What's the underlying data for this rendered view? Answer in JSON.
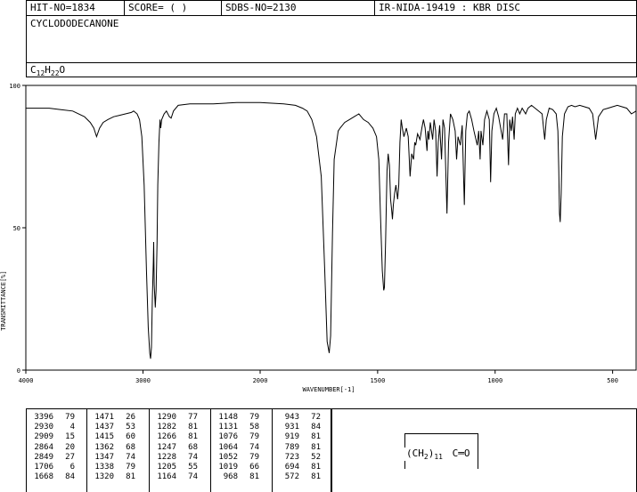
{
  "header": {
    "hit_no": "HIT-NO=1834",
    "score": "SCORE=  (   )",
    "sdbs_no": "SDBS-NO=2130",
    "ir_nida": "IR-NIDA-19419 : KBR DISC",
    "compound_name": "CYCLODODECANONE",
    "formula": {
      "c": "C",
      "c_sub": "12",
      "h": "H",
      "h_sub": "22",
      "o": "O"
    }
  },
  "chart_data": {
    "type": "line",
    "xlabel": "WAVENUMBER[-1]",
    "ylabel": "TRANSMITTANCE[%]",
    "xlim": [
      4000,
      400
    ],
    "ylim": [
      0,
      100
    ],
    "x_ticks": [
      4000,
      3000,
      2000,
      1500,
      1000,
      500
    ],
    "x_tick_labels": [
      "4000",
      "3000",
      "2000",
      "1500",
      "1000",
      "500"
    ],
    "y_ticks": [
      0,
      50,
      100
    ],
    "y_tick_labels": [
      "0",
      "50",
      "100"
    ],
    "series": [
      {
        "points": [
          [
            4000,
            92
          ],
          [
            3900,
            92
          ],
          [
            3800,
            92
          ],
          [
            3700,
            91.5
          ],
          [
            3600,
            91
          ],
          [
            3500,
            89
          ],
          [
            3450,
            87
          ],
          [
            3420,
            85
          ],
          [
            3396,
            82
          ],
          [
            3370,
            85
          ],
          [
            3340,
            87
          ],
          [
            3300,
            88
          ],
          [
            3250,
            89
          ],
          [
            3200,
            89.5
          ],
          [
            3150,
            90
          ],
          [
            3100,
            90.5
          ],
          [
            3080,
            91
          ],
          [
            3050,
            90
          ],
          [
            3030,
            88
          ],
          [
            3010,
            82
          ],
          [
            2990,
            65
          ],
          [
            2970,
            35
          ],
          [
            2955,
            15
          ],
          [
            2942,
            6
          ],
          [
            2935,
            4
          ],
          [
            2928,
            8
          ],
          [
            2920,
            25
          ],
          [
            2912,
            38
          ],
          [
            2909,
            45
          ],
          [
            2904,
            30
          ],
          [
            2895,
            22
          ],
          [
            2888,
            28
          ],
          [
            2880,
            45
          ],
          [
            2874,
            65
          ],
          [
            2864,
            80
          ],
          [
            2855,
            88
          ],
          [
            2849,
            85
          ],
          [
            2840,
            88
          ],
          [
            2820,
            90
          ],
          [
            2800,
            91
          ],
          [
            2775,
            89
          ],
          [
            2760,
            88.5
          ],
          [
            2740,
            91
          ],
          [
            2700,
            93
          ],
          [
            2600,
            93.5
          ],
          [
            2400,
            93.5
          ],
          [
            2200,
            94
          ],
          [
            2000,
            94
          ],
          [
            1900,
            93.5
          ],
          [
            1850,
            93
          ],
          [
            1820,
            92
          ],
          [
            1800,
            91
          ],
          [
            1780,
            88
          ],
          [
            1760,
            82
          ],
          [
            1740,
            68
          ],
          [
            1725,
            35
          ],
          [
            1715,
            10
          ],
          [
            1706,
            6
          ],
          [
            1700,
            12
          ],
          [
            1692,
            48
          ],
          [
            1685,
            74
          ],
          [
            1668,
            84
          ],
          [
            1660,
            85
          ],
          [
            1640,
            87
          ],
          [
            1620,
            88
          ],
          [
            1600,
            89
          ],
          [
            1580,
            90
          ],
          [
            1560,
            88
          ],
          [
            1540,
            87
          ],
          [
            1520,
            85
          ],
          [
            1505,
            82
          ],
          [
            1495,
            74
          ],
          [
            1488,
            55
          ],
          [
            1480,
            35
          ],
          [
            1474,
            28
          ],
          [
            1471,
            29
          ],
          [
            1466,
            45
          ],
          [
            1460,
            70
          ],
          [
            1455,
            76
          ],
          [
            1450,
            72
          ],
          [
            1445,
            60
          ],
          [
            1440,
            56
          ],
          [
            1437,
            53
          ],
          [
            1433,
            58
          ],
          [
            1428,
            62
          ],
          [
            1422,
            65
          ],
          [
            1415,
            60
          ],
          [
            1410,
            65
          ],
          [
            1405,
            80
          ],
          [
            1400,
            88
          ],
          [
            1395,
            85
          ],
          [
            1388,
            82
          ],
          [
            1378,
            85
          ],
          [
            1370,
            82
          ],
          [
            1362,
            68
          ],
          [
            1355,
            76
          ],
          [
            1347,
            74
          ],
          [
            1342,
            80
          ],
          [
            1338,
            79
          ],
          [
            1330,
            83
          ],
          [
            1320,
            81
          ],
          [
            1312,
            85
          ],
          [
            1305,
            88
          ],
          [
            1298,
            85
          ],
          [
            1290,
            77
          ],
          [
            1286,
            84
          ],
          [
            1282,
            81
          ],
          [
            1276,
            87
          ],
          [
            1266,
            81
          ],
          [
            1260,
            88
          ],
          [
            1253,
            84
          ],
          [
            1247,
            68
          ],
          [
            1242,
            80
          ],
          [
            1236,
            86
          ],
          [
            1228,
            74
          ],
          [
            1222,
            88
          ],
          [
            1215,
            85
          ],
          [
            1205,
            55
          ],
          [
            1198,
            80
          ],
          [
            1190,
            90
          ],
          [
            1180,
            88
          ],
          [
            1170,
            84
          ],
          [
            1164,
            74
          ],
          [
            1158,
            82
          ],
          [
            1148,
            79
          ],
          [
            1140,
            86
          ],
          [
            1131,
            58
          ],
          [
            1125,
            84
          ],
          [
            1118,
            90
          ],
          [
            1110,
            91
          ],
          [
            1100,
            88
          ],
          [
            1090,
            84
          ],
          [
            1076,
            79
          ],
          [
            1070,
            84
          ],
          [
            1064,
            74
          ],
          [
            1060,
            84
          ],
          [
            1052,
            79
          ],
          [
            1045,
            88
          ],
          [
            1035,
            91
          ],
          [
            1025,
            88
          ],
          [
            1019,
            66
          ],
          [
            1014,
            84
          ],
          [
            1005,
            90
          ],
          [
            995,
            92
          ],
          [
            985,
            89
          ],
          [
            968,
            81
          ],
          [
            960,
            90
          ],
          [
            950,
            90
          ],
          [
            943,
            72
          ],
          [
            938,
            88
          ],
          [
            931,
            84
          ],
          [
            926,
            89
          ],
          [
            919,
            81
          ],
          [
            914,
            90
          ],
          [
            905,
            92
          ],
          [
            895,
            90
          ],
          [
            885,
            92
          ],
          [
            870,
            90
          ],
          [
            860,
            92
          ],
          [
            845,
            93
          ],
          [
            830,
            92
          ],
          [
            815,
            91
          ],
          [
            800,
            90
          ],
          [
            789,
            81
          ],
          [
            782,
            88
          ],
          [
            770,
            92
          ],
          [
            755,
            91.5
          ],
          [
            740,
            90
          ],
          [
            733,
            84
          ],
          [
            729,
            70
          ],
          [
            726,
            55
          ],
          [
            723,
            52
          ],
          [
            719,
            62
          ],
          [
            714,
            82
          ],
          [
            705,
            90
          ],
          [
            690,
            92.5
          ],
          [
            675,
            93
          ],
          [
            660,
            92.5
          ],
          [
            640,
            93
          ],
          [
            620,
            92.5
          ],
          [
            600,
            92
          ],
          [
            585,
            90
          ],
          [
            578,
            85
          ],
          [
            572,
            81
          ],
          [
            566,
            85
          ],
          [
            560,
            89
          ],
          [
            540,
            91.5
          ],
          [
            520,
            92
          ],
          [
            500,
            92.5
          ],
          [
            480,
            93
          ],
          [
            460,
            92.5
          ],
          [
            440,
            92
          ],
          [
            420,
            90
          ],
          [
            400,
            91
          ]
        ]
      }
    ]
  },
  "peak_table": {
    "columns": [
      [
        [
          "3396",
          "79"
        ],
        [
          "2930",
          "4"
        ],
        [
          "2909",
          "15"
        ],
        [
          "2864",
          "20"
        ],
        [
          "2849",
          "27"
        ],
        [
          "1706",
          "6"
        ],
        [
          "1668",
          "84"
        ]
      ],
      [
        [
          "1471",
          "26"
        ],
        [
          "1437",
          "53"
        ],
        [
          "1415",
          "60"
        ],
        [
          "1362",
          "68"
        ],
        [
          "1347",
          "74"
        ],
        [
          "1338",
          "79"
        ],
        [
          "1320",
          "81"
        ]
      ],
      [
        [
          "1290",
          "77"
        ],
        [
          "1282",
          "81"
        ],
        [
          "1266",
          "81"
        ],
        [
          "1247",
          "68"
        ],
        [
          "1228",
          "74"
        ],
        [
          "1205",
          "55"
        ],
        [
          "1164",
          "74"
        ]
      ],
      [
        [
          "1148",
          "79"
        ],
        [
          "1131",
          "58"
        ],
        [
          "1076",
          "79"
        ],
        [
          "1064",
          "74"
        ],
        [
          "1052",
          "79"
        ],
        [
          "1019",
          "66"
        ],
        [
          "968",
          "81"
        ]
      ],
      [
        [
          "943",
          "72"
        ],
        [
          "931",
          "84"
        ],
        [
          "919",
          "81"
        ],
        [
          "789",
          "81"
        ],
        [
          "723",
          "52"
        ],
        [
          "694",
          "81"
        ],
        [
          "572",
          "81"
        ]
      ]
    ]
  },
  "structure": {
    "left": "(CH",
    "sub2": "2",
    "right": ")",
    "sub11": "11",
    "carbonyl": "C═O"
  }
}
